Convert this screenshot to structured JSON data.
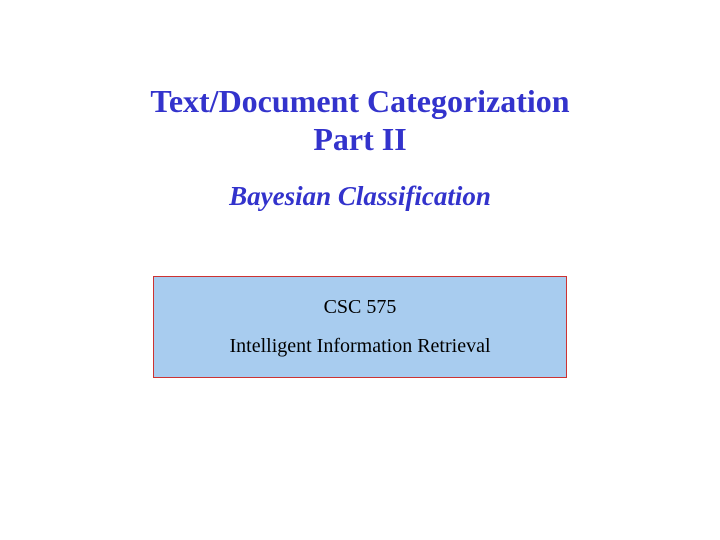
{
  "title": {
    "line1": "Text/Document Categorization",
    "line2": "Part II"
  },
  "subtitle": "Bayesian Classification",
  "course": {
    "code": "CSC 575",
    "name": "Intelligent Information Retrieval"
  }
}
